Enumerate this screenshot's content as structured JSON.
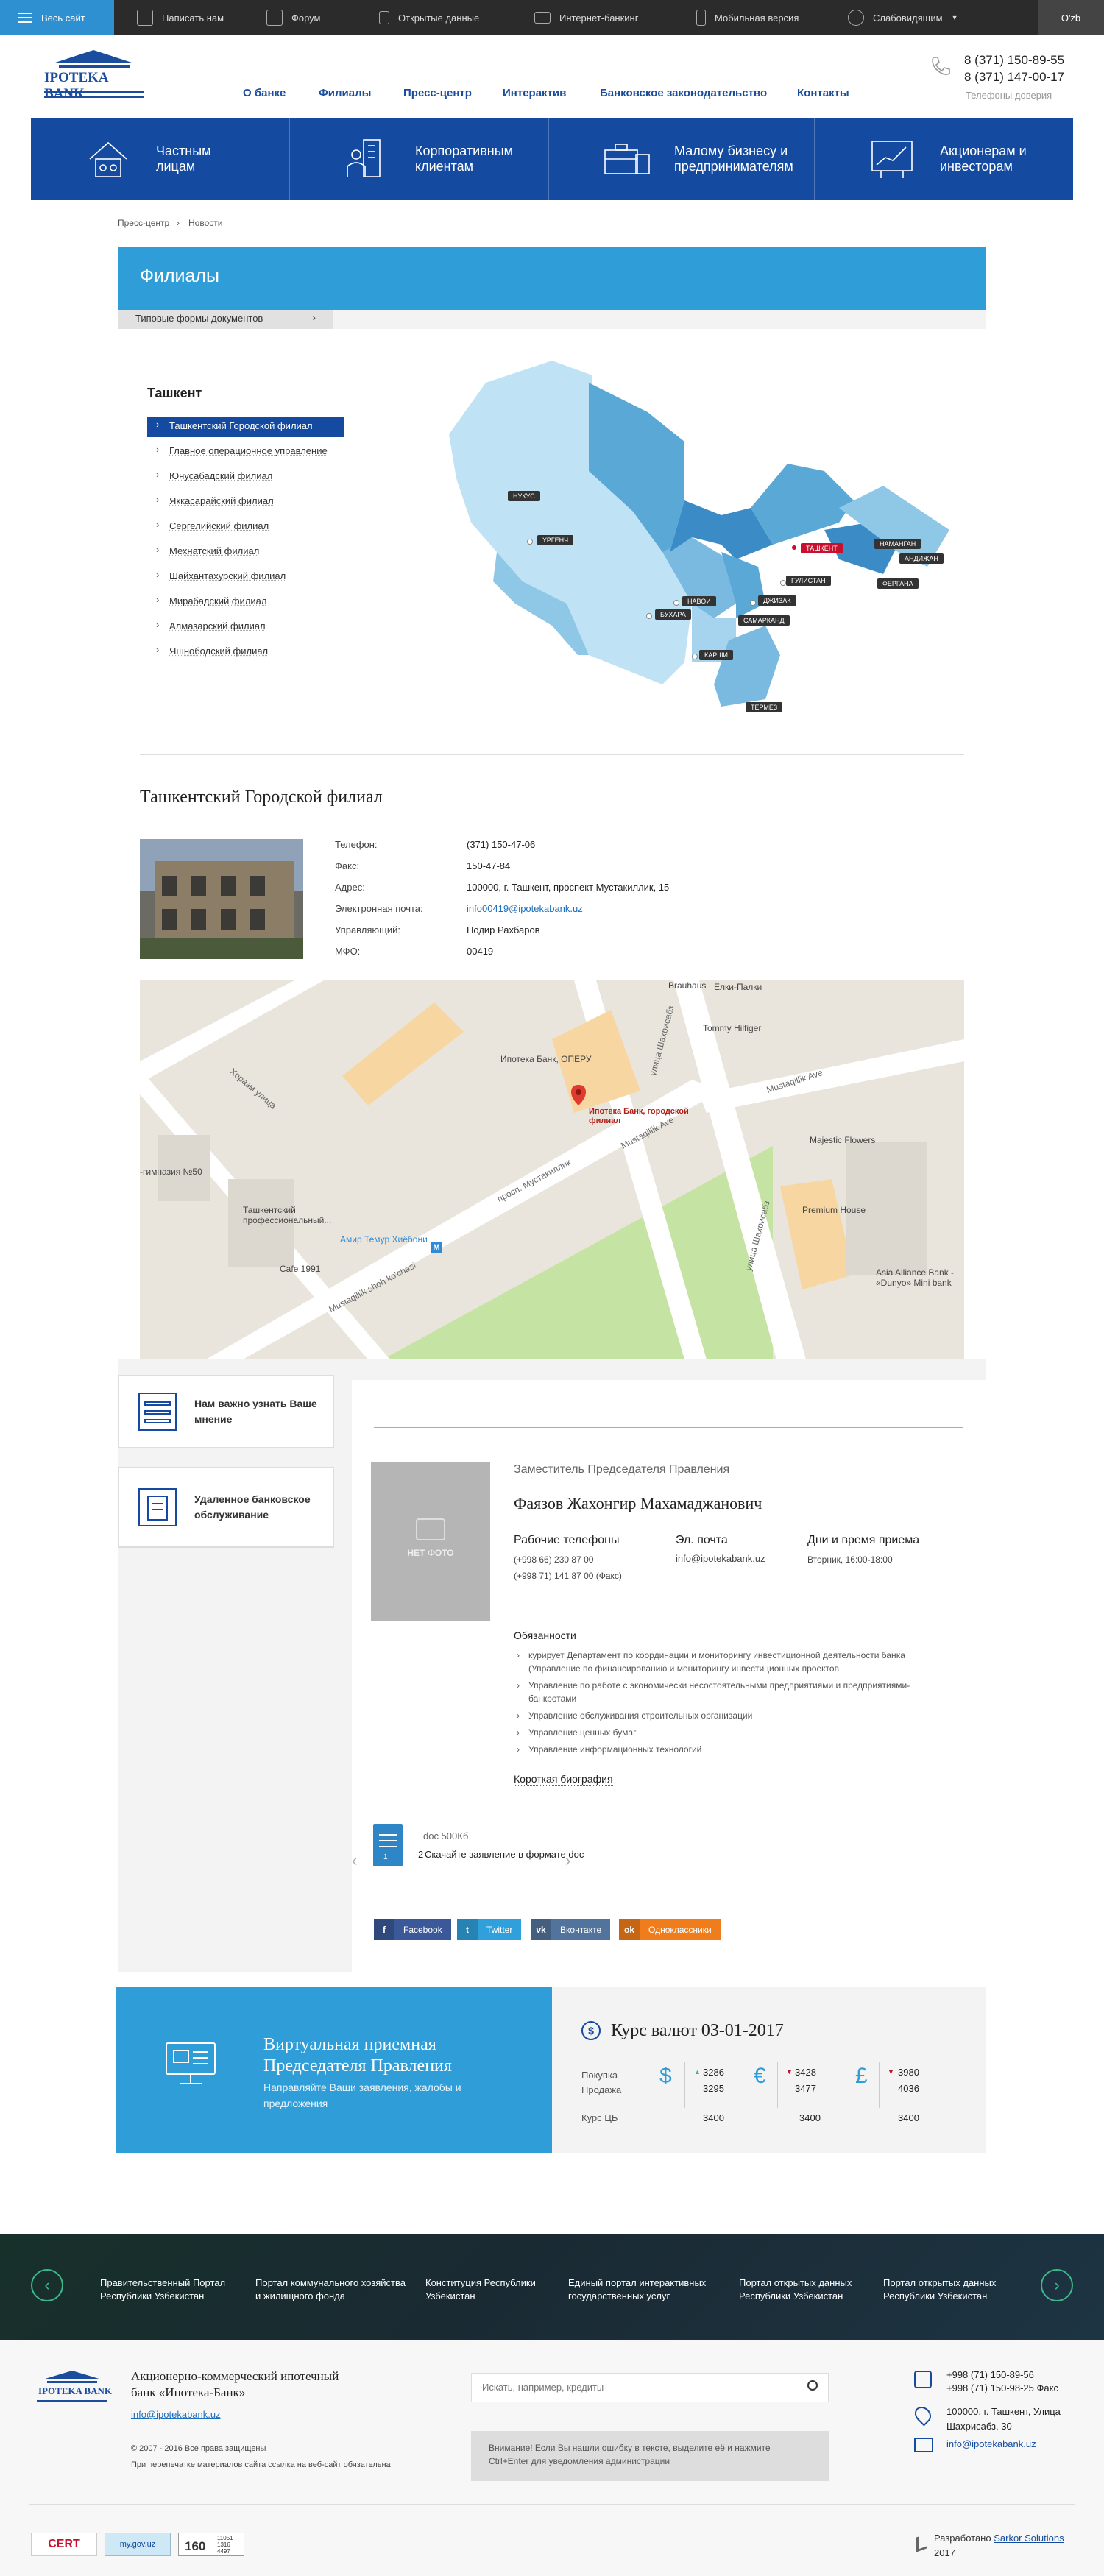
{
  "topbar": {
    "all_site": "Весь сайт",
    "items": [
      "Написать нам",
      "Форум",
      "Открытые данные",
      "Интернет-банкинг",
      "Мобильная версия",
      "Слабовидящим"
    ],
    "lang": "O'zb"
  },
  "header": {
    "logo_text": "IPOTEKA BANK",
    "nav": [
      "О банке",
      "Филиалы",
      "Пресс-центр",
      "Интерактив",
      "Банковское законодательство",
      "Контакты"
    ],
    "phone1": "8 (371) 150-89-55",
    "phone2": "8 (371) 147-00-17",
    "phone_label": "Телефоны доверия"
  },
  "categories": [
    {
      "label": "Частным лицам",
      "icon": "family-car-icon"
    },
    {
      "label": "Корпоративным клиентам",
      "icon": "business-people-icon"
    },
    {
      "label": "Малому бизнесу и предпринимателям",
      "icon": "briefcase-icon"
    },
    {
      "label": "Акционерам и инвесторам",
      "icon": "growth-chart-icon"
    }
  ],
  "breadcrumb": {
    "part1": "Пресс-центр",
    "sep": "›",
    "part2": "Новости"
  },
  "section": {
    "title": "Филиалы",
    "tab": "Типовые формы документов"
  },
  "branches": {
    "region": "Ташкент",
    "items": [
      "Ташкентский Городской филиал",
      "Главное операционное управление",
      "Юнусабадский филиал",
      "Яккасарайский филиал",
      "Сергелийский филиал",
      "Мехнатский филиал",
      "Шайхантахурский филиал",
      "Мирабадский филиал",
      "Алмазарский филиал",
      "Яшнободский филиал"
    ]
  },
  "map_labels": [
    "НУКУС",
    "УРГЕНЧ",
    "НАВОИ",
    "БУХАРА",
    "САМАРКАНД",
    "ДЖИЗАК",
    "ГУЛИСТАН",
    "ТАШКЕНТ",
    "НАМАНГАН",
    "АНДИЖАН",
    "ФЕРГАНА",
    "КАРШИ",
    "ТЕРМЕЗ"
  ],
  "branch_info": {
    "title": "Ташкентский Городской филиал",
    "rows": [
      {
        "k": "Телефон:",
        "v": "(371) 150-47-06"
      },
      {
        "k": "Факс:",
        "v": "150-47-84"
      },
      {
        "k": "Адрес:",
        "v": "100000, г. Ташкент, проспект Мустакиллик, 15"
      },
      {
        "k": "Электронная почта:",
        "v": "info00419@ipotekabank.uz"
      },
      {
        "k": "Управляющий:",
        "v": "Нодир Рахбаров"
      },
      {
        "k": "МФО:",
        "v": "00419"
      }
    ]
  },
  "gmap": {
    "pin_label": "Ипотека Банк, городской филиал",
    "places": [
      "Brauhaus",
      "Ёлки-Палки",
      "Tommy Hilfiger",
      "Ипотека Банк, ОПЕРУ",
      "Majestic Flowers",
      "Premium House",
      "Asia Alliance Bank - «Dunyo» Mini bank",
      "-гимназия №50",
      "Ташкентский профессиональный...",
      "Cafe 1991",
      "Амир Темур Хиёбони"
    ],
    "streets": [
      "Хоразм улица",
      "просп. Мустакиллик",
      "Mustaqillik Ave",
      "Mustaqillik shoh ko'chasi",
      "улица Шахрисабз",
      "улица Шахрисабз",
      "Mustaqillik Ave"
    ],
    "metro": "M"
  },
  "sidebar": [
    {
      "label": "Нам важно узнать Ваше мнение",
      "icon": "inbox-icon"
    },
    {
      "label": "Удаленное банковское обслуживание",
      "icon": "document-icon"
    }
  ],
  "profile": {
    "photo_label": "НЕТ ФОТО",
    "position": "Заместитель Председателя Правления",
    "name": "Фаязов Жахонгир Махамаджанович",
    "phones_h": "Рабочие телефоны",
    "phone1": "(+998 66) 230 87 00",
    "phone2": "(+998 71) 141 87 00 (Факс)",
    "email_h": "Эл. почта",
    "email": "info@ipotekabank.uz",
    "days_h": "Дни и время приема",
    "days": "Вторник, 16:00-18:00",
    "duties_h": "Обязанности",
    "duties": [
      "курирует Департамент по координации и мониторингу инвестиционной деятельности банка (Управление по финансированию и мониторингу инвестиционных проектов",
      "Управление по работе с экономически несостоятельными предприятиями и предприятиями-банкротами",
      "Управление обслуживания строительных организаций",
      "Управление ценных бумаг",
      "Управление информационных технологий"
    ],
    "bio": "Короткая биография",
    "doc_size": "doc 500Кб",
    "doc_text": "Скачайте заявление в формате doc",
    "doc_overlap": "2",
    "doc_page": "1"
  },
  "social": [
    "Facebook",
    "Twitter",
    "Вконтакте",
    "Одноклассники"
  ],
  "reception": {
    "title": "Виртуальная приемная Председателя Правления",
    "desc": "Направляйте Ваши заявления, жалобы и предложения"
  },
  "rates": {
    "title": "Курс валют 03-01-2017",
    "buy": "Покупка",
    "sell": "Продажа",
    "cb": "Курс ЦБ",
    "usd": {
      "sym": "$",
      "buy": "3286",
      "sell": "3295",
      "cb": "3400"
    },
    "eur": {
      "sym": "€",
      "buy": "3428",
      "sell": "3477",
      "cb": "3400"
    },
    "gbp": {
      "sym": "£",
      "buy": "3980",
      "sell": "4036",
      "cb": "3400"
    }
  },
  "footer_links": [
    "Правительственный Портал Республики Узбекистан",
    "Портал коммунального хозяйства и жилищного фонда",
    "Конституция Республики Узбекистан",
    "Единый портал интерактивных государственных услуг",
    "Портал открытых данных Республики Узбекистан",
    "Портал открытых данных Республики Узбекистан"
  ],
  "footer": {
    "bank_name": "Акционерно-коммерческий ипотечный банк «Ипотека-Банк»",
    "email": "info@ipotekabank.uz",
    "copyright": "© 2007 - 2016 Все права защищены",
    "reprint": "При перепечатке материалов сайта ссылка на веб-сайт обязательна",
    "search_placeholder": "Искать, например, кредиты",
    "notice": "Внимание! Если Вы нашли ошибку в тексте, выделите её и нажмите Ctrl+Enter для уведомления администрации",
    "phone1": "+998 (71) 150-89-56",
    "phone2": "+998 (71) 150-98-25 Факс",
    "address": "100000, г. Ташкент, Улица Шахрисабз, 30",
    "email2": "info@ipotekabank.uz",
    "dev_prefix": "Разработано",
    "dev_name": "Sarkor Solutions",
    "dev_year": "2017",
    "badge1": "CERT",
    "badge2": "my.gov.uz",
    "badge3_main": "160",
    "badge3_top": "11051",
    "badge3_mid": "1316",
    "badge3_bot": "4497"
  }
}
